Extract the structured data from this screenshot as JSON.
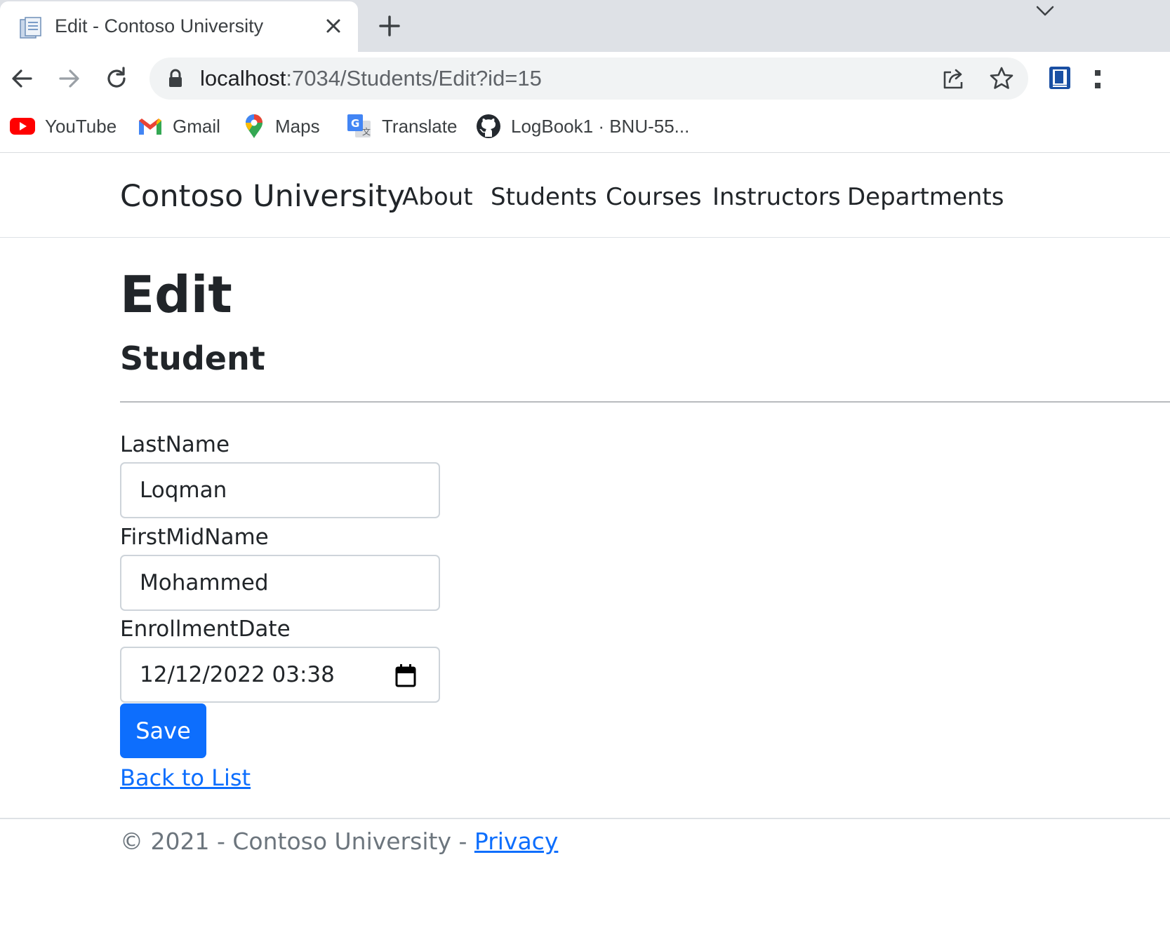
{
  "browser": {
    "tab_title": "Edit - Contoso University",
    "url_host": "localhost",
    "url_path": ":7034/Students/Edit?id=15",
    "bookmarks": [
      {
        "label": "YouTube",
        "icon": "youtube-icon"
      },
      {
        "label": "Gmail",
        "icon": "gmail-icon"
      },
      {
        "label": "Maps",
        "icon": "maps-icon"
      },
      {
        "label": "Translate",
        "icon": "translate-icon"
      },
      {
        "label": "LogBook1 · BNU-55...",
        "icon": "github-icon"
      }
    ]
  },
  "site": {
    "brand": "Contoso University",
    "nav": [
      "About",
      "Students",
      "Courses",
      "Instructors",
      "Departments"
    ]
  },
  "page": {
    "title": "Edit",
    "subtitle": "Student",
    "fields": {
      "last_name_label": "LastName",
      "last_name_value": "Loqman",
      "first_mid_name_label": "FirstMidName",
      "first_mid_name_value": "Mohammed",
      "enrollment_date_label": "EnrollmentDate",
      "enrollment_date_value": "12/12/2022 03:38"
    },
    "save_label": "Save",
    "back_link": "Back to List"
  },
  "footer": {
    "text": "© 2021 - Contoso University - ",
    "privacy_link": "Privacy"
  },
  "colors": {
    "primary": "#0d6efd",
    "tabstrip": "#dee1e6",
    "omnibox": "#f1f3f4"
  }
}
